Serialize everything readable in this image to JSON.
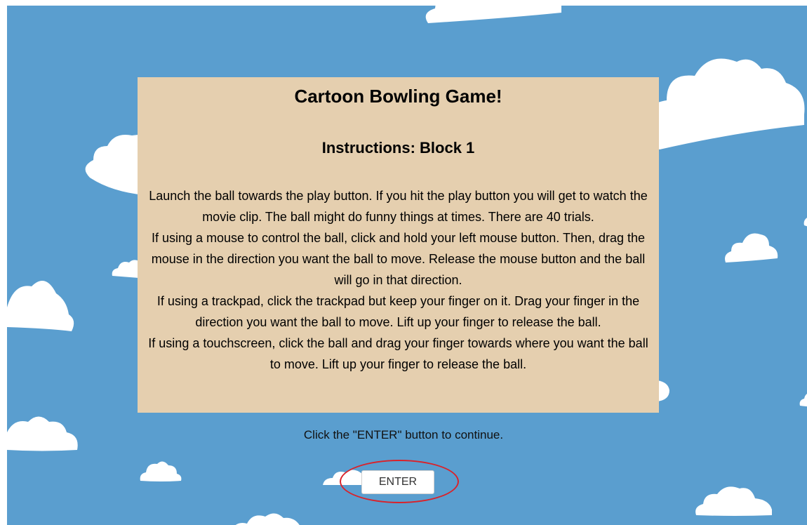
{
  "game": {
    "title": "Cartoon Bowling Game!",
    "subtitle": "Instructions: Block 1",
    "paragraphs": [
      "Launch the ball towards the play button. If you hit the play button you will get to watch the movie clip. The ball might do funny things at times. There are 40 trials.",
      "If using a mouse to control the ball, click and hold your left mouse button. Then, drag the mouse in the direction you want the ball to move. Release the mouse button and the ball will go in that direction.",
      "If using a trackpad, click the trackpad but keep your finger on it. Drag your finger in the direction you want the ball to move. Lift up your finger to release the ball.",
      "If using a touchscreen, click the ball and drag your finger towards where you want the ball to move. Lift up your finger to release the ball."
    ],
    "hint": "Click the \"ENTER\" button to continue.",
    "enter_label": "ENTER"
  },
  "colors": {
    "sky": "#5a9ecf",
    "panel": "#e5cfaf",
    "cloud": "#ffffff",
    "highlight": "#d9222a"
  }
}
